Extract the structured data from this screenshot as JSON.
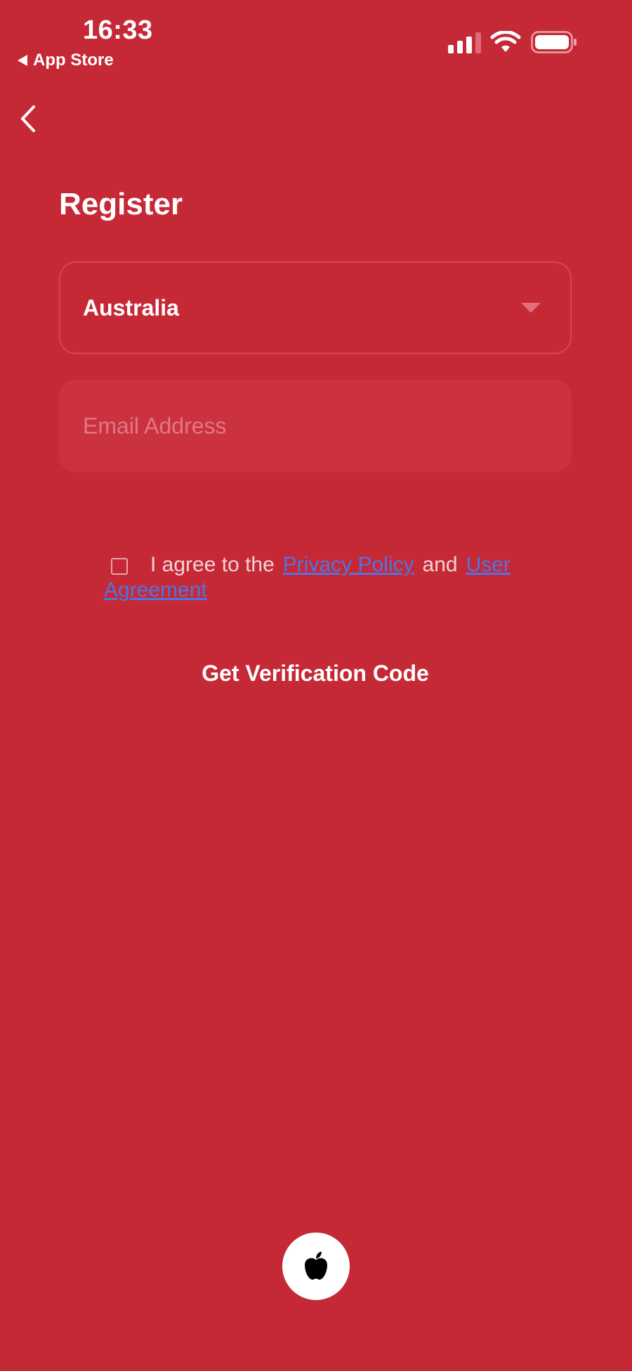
{
  "status_bar": {
    "time": "16:33",
    "back_app": "App Store"
  },
  "header": {
    "title": "Register"
  },
  "form": {
    "region": "Australia",
    "email_placeholder": "Email Address",
    "email_value": ""
  },
  "agreement": {
    "prefix": "I agree to the",
    "privacy_link": "Privacy Policy",
    "conjunction": "and",
    "user_agreement_link": "User Agreement",
    "checked": false
  },
  "actions": {
    "get_code": "Get Verification Code"
  },
  "icons": {
    "back": "chevron-left-icon",
    "dropdown": "caret-down-icon",
    "apple": "apple-logo-icon"
  },
  "colors": {
    "background": "#c62936",
    "field_fill": "#cb313e",
    "link": "#4f74e3",
    "text": "#ffffff"
  }
}
